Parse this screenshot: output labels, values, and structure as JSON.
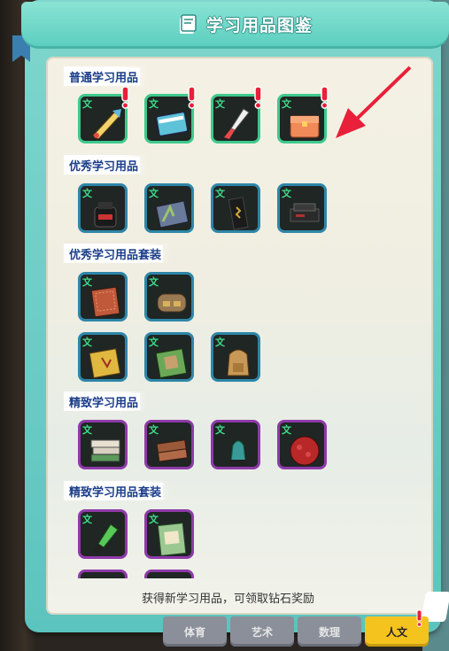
{
  "header": {
    "title": "学习用品图鉴",
    "icon": "book-icon"
  },
  "sections": [
    {
      "label": "普通学习用品"
    },
    {
      "label": "优秀学习用品"
    },
    {
      "label": "优秀学习用品套装"
    },
    {
      "label": "精致学习用品"
    },
    {
      "label": "精致学习用品套装"
    }
  ],
  "item_badge": "文",
  "footer": {
    "note": "获得新学习用品，可领取钻石奖励"
  },
  "tabs": [
    {
      "label": "体育",
      "active": false
    },
    {
      "label": "艺术",
      "active": false
    },
    {
      "label": "数理",
      "active": false
    },
    {
      "label": "人文",
      "active": true
    }
  ],
  "colors": {
    "common_border": "#3ec98c",
    "excellent_border": "#2e86a8",
    "fine_border": "#8f3aa8",
    "active_tab": "#f4c31e",
    "alert": "#e8203a"
  }
}
